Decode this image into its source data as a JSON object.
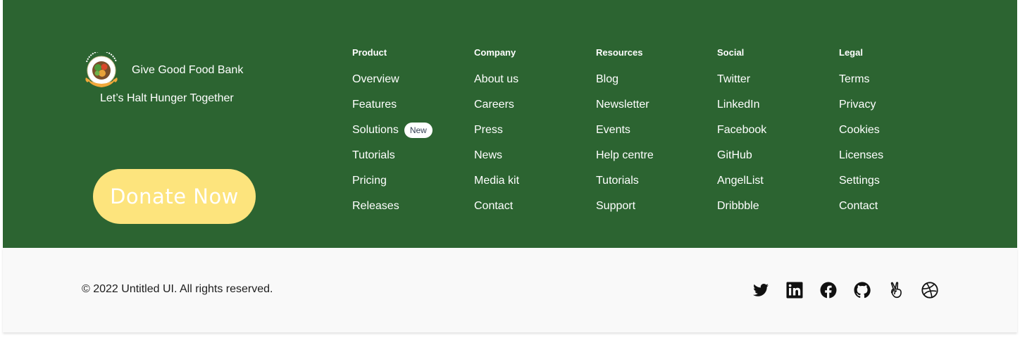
{
  "brand": {
    "name": "Give Good Food Bank",
    "tagline": "Let’s Halt Hunger Together"
  },
  "donate": {
    "label": "Donate Now"
  },
  "columns": [
    {
      "title": "Product",
      "items": [
        {
          "label": "Overview"
        },
        {
          "label": "Features"
        },
        {
          "label": "Solutions",
          "badge": "New"
        },
        {
          "label": "Tutorials"
        },
        {
          "label": "Pricing"
        },
        {
          "label": "Releases"
        }
      ]
    },
    {
      "title": "Company",
      "items": [
        {
          "label": "About us"
        },
        {
          "label": "Careers"
        },
        {
          "label": "Press"
        },
        {
          "label": "News"
        },
        {
          "label": "Media kit"
        },
        {
          "label": "Contact"
        }
      ]
    },
    {
      "title": "Resources",
      "items": [
        {
          "label": "Blog"
        },
        {
          "label": "Newsletter"
        },
        {
          "label": "Events"
        },
        {
          "label": "Help centre"
        },
        {
          "label": "Tutorials"
        },
        {
          "label": "Support"
        }
      ]
    },
    {
      "title": "Social",
      "items": [
        {
          "label": "Twitter"
        },
        {
          "label": "LinkedIn"
        },
        {
          "label": "Facebook"
        },
        {
          "label": "GitHub"
        },
        {
          "label": "AngelList"
        },
        {
          "label": "Dribbble"
        }
      ]
    },
    {
      "title": "Legal",
      "items": [
        {
          "label": "Terms"
        },
        {
          "label": "Privacy"
        },
        {
          "label": "Cookies"
        },
        {
          "label": "Licenses"
        },
        {
          "label": "Settings"
        },
        {
          "label": "Contact"
        }
      ]
    }
  ],
  "footer": {
    "copyright": "© 2022 Untitled UI. All rights reserved.",
    "social_icons": [
      "twitter-icon",
      "linkedin-icon",
      "facebook-icon",
      "github-icon",
      "angellist-icon",
      "dribbble-icon"
    ]
  },
  "colors": {
    "footer_green": "#2c6431",
    "donate_yellow": "#fde47d",
    "bottom_bar": "#f9f9f9"
  }
}
